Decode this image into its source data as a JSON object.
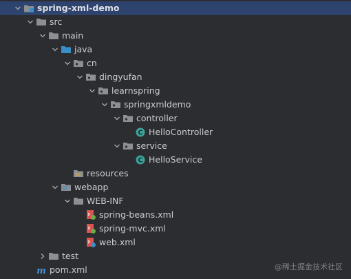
{
  "tree": [
    {
      "label": "spring-xml-demo",
      "depth": 0,
      "expanded": true,
      "icon": "module-folder-icon",
      "bold": true,
      "selected": true,
      "name": "project-root-spring-xml-demo"
    },
    {
      "label": "src",
      "depth": 1,
      "expanded": true,
      "icon": "folder-icon",
      "name": "folder-src"
    },
    {
      "label": "main",
      "depth": 2,
      "expanded": true,
      "icon": "folder-icon",
      "name": "folder-main"
    },
    {
      "label": "java",
      "depth": 3,
      "expanded": true,
      "icon": "source-root-folder-icon",
      "name": "folder-java"
    },
    {
      "label": "cn",
      "depth": 4,
      "expanded": true,
      "icon": "package-icon",
      "name": "package-cn"
    },
    {
      "label": "dingyufan",
      "depth": 5,
      "expanded": true,
      "icon": "package-icon",
      "name": "package-dingyufan"
    },
    {
      "label": "learnspring",
      "depth": 6,
      "expanded": true,
      "icon": "package-icon",
      "name": "package-learnspring"
    },
    {
      "label": "springxmldemo",
      "depth": 7,
      "expanded": true,
      "icon": "package-icon",
      "name": "package-springxmldemo"
    },
    {
      "label": "controller",
      "depth": 8,
      "expanded": true,
      "icon": "package-icon",
      "name": "package-controller"
    },
    {
      "label": "HelloController",
      "depth": 9,
      "icon": "class-icon",
      "name": "file-hellocontroller"
    },
    {
      "label": "service",
      "depth": 8,
      "expanded": true,
      "icon": "package-icon",
      "name": "package-service"
    },
    {
      "label": "HelloService",
      "depth": 9,
      "icon": "class-icon",
      "name": "file-helloservice"
    },
    {
      "label": "resources",
      "depth": 4,
      "icon": "resources-folder-icon",
      "name": "folder-resources"
    },
    {
      "label": "webapp",
      "depth": 3,
      "expanded": true,
      "icon": "web-folder-icon",
      "name": "folder-webapp"
    },
    {
      "label": "WEB-INF",
      "depth": 4,
      "expanded": true,
      "icon": "folder-icon",
      "name": "folder-web-inf"
    },
    {
      "label": "spring-beans.xml",
      "depth": 5,
      "icon": "spring-xml-file-icon",
      "name": "file-spring-beans-xml"
    },
    {
      "label": "spring-mvc.xml",
      "depth": 5,
      "icon": "spring-xml-file-icon",
      "name": "file-spring-mvc-xml"
    },
    {
      "label": "web.xml",
      "depth": 5,
      "icon": "web-xml-file-icon",
      "name": "file-web-xml"
    },
    {
      "label": "test",
      "depth": 2,
      "expanded": false,
      "icon": "folder-icon",
      "name": "folder-test"
    },
    {
      "label": "pom.xml",
      "depth": 1,
      "icon": "maven-file-icon",
      "name": "file-pom-xml"
    }
  ],
  "watermark": {
    "text": "@稀土掘金技术社区"
  },
  "colors": {
    "background": "#2b2d30",
    "selection": "#2e436e",
    "text": "#c9ccd2",
    "folder": "#8c8f94",
    "source_root": "#3a8ec7",
    "class": "#3aa39b",
    "xml_red": "#d9534f",
    "spring_green": "#6aab4a",
    "maven": "#4a90d9"
  }
}
